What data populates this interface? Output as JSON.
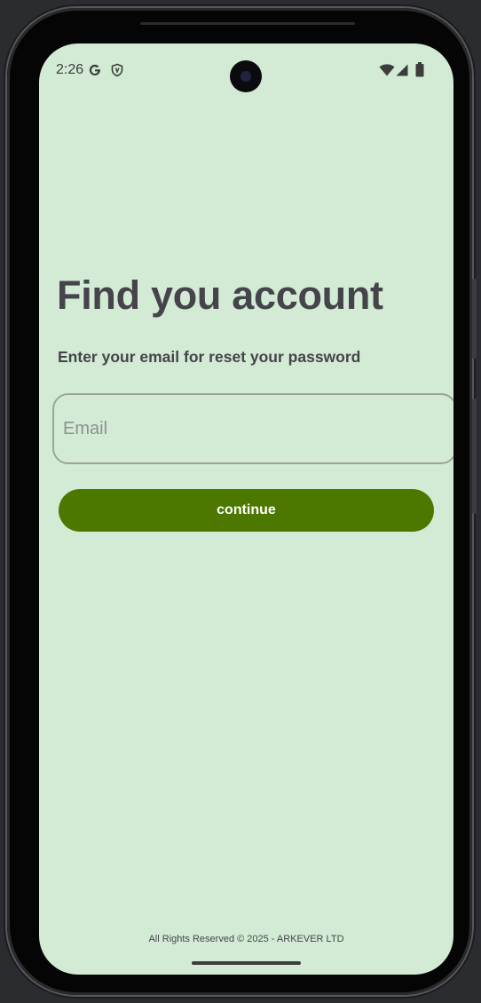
{
  "status_bar": {
    "time": "2:26",
    "icons": [
      "google-icon",
      "shield-icon",
      "wifi-icon",
      "signal-icon",
      "battery-icon"
    ]
  },
  "page": {
    "title": "Find you account",
    "subtitle": "Enter your email for reset your password"
  },
  "form": {
    "email_placeholder": "Email",
    "email_value": "",
    "continue_label": "continue"
  },
  "footer": {
    "text": "All Rights Reserved © 2025 - ARKEVER LTD"
  },
  "colors": {
    "background": "#d3ebd5",
    "accent": "#4c7800",
    "text": "#45444a"
  }
}
